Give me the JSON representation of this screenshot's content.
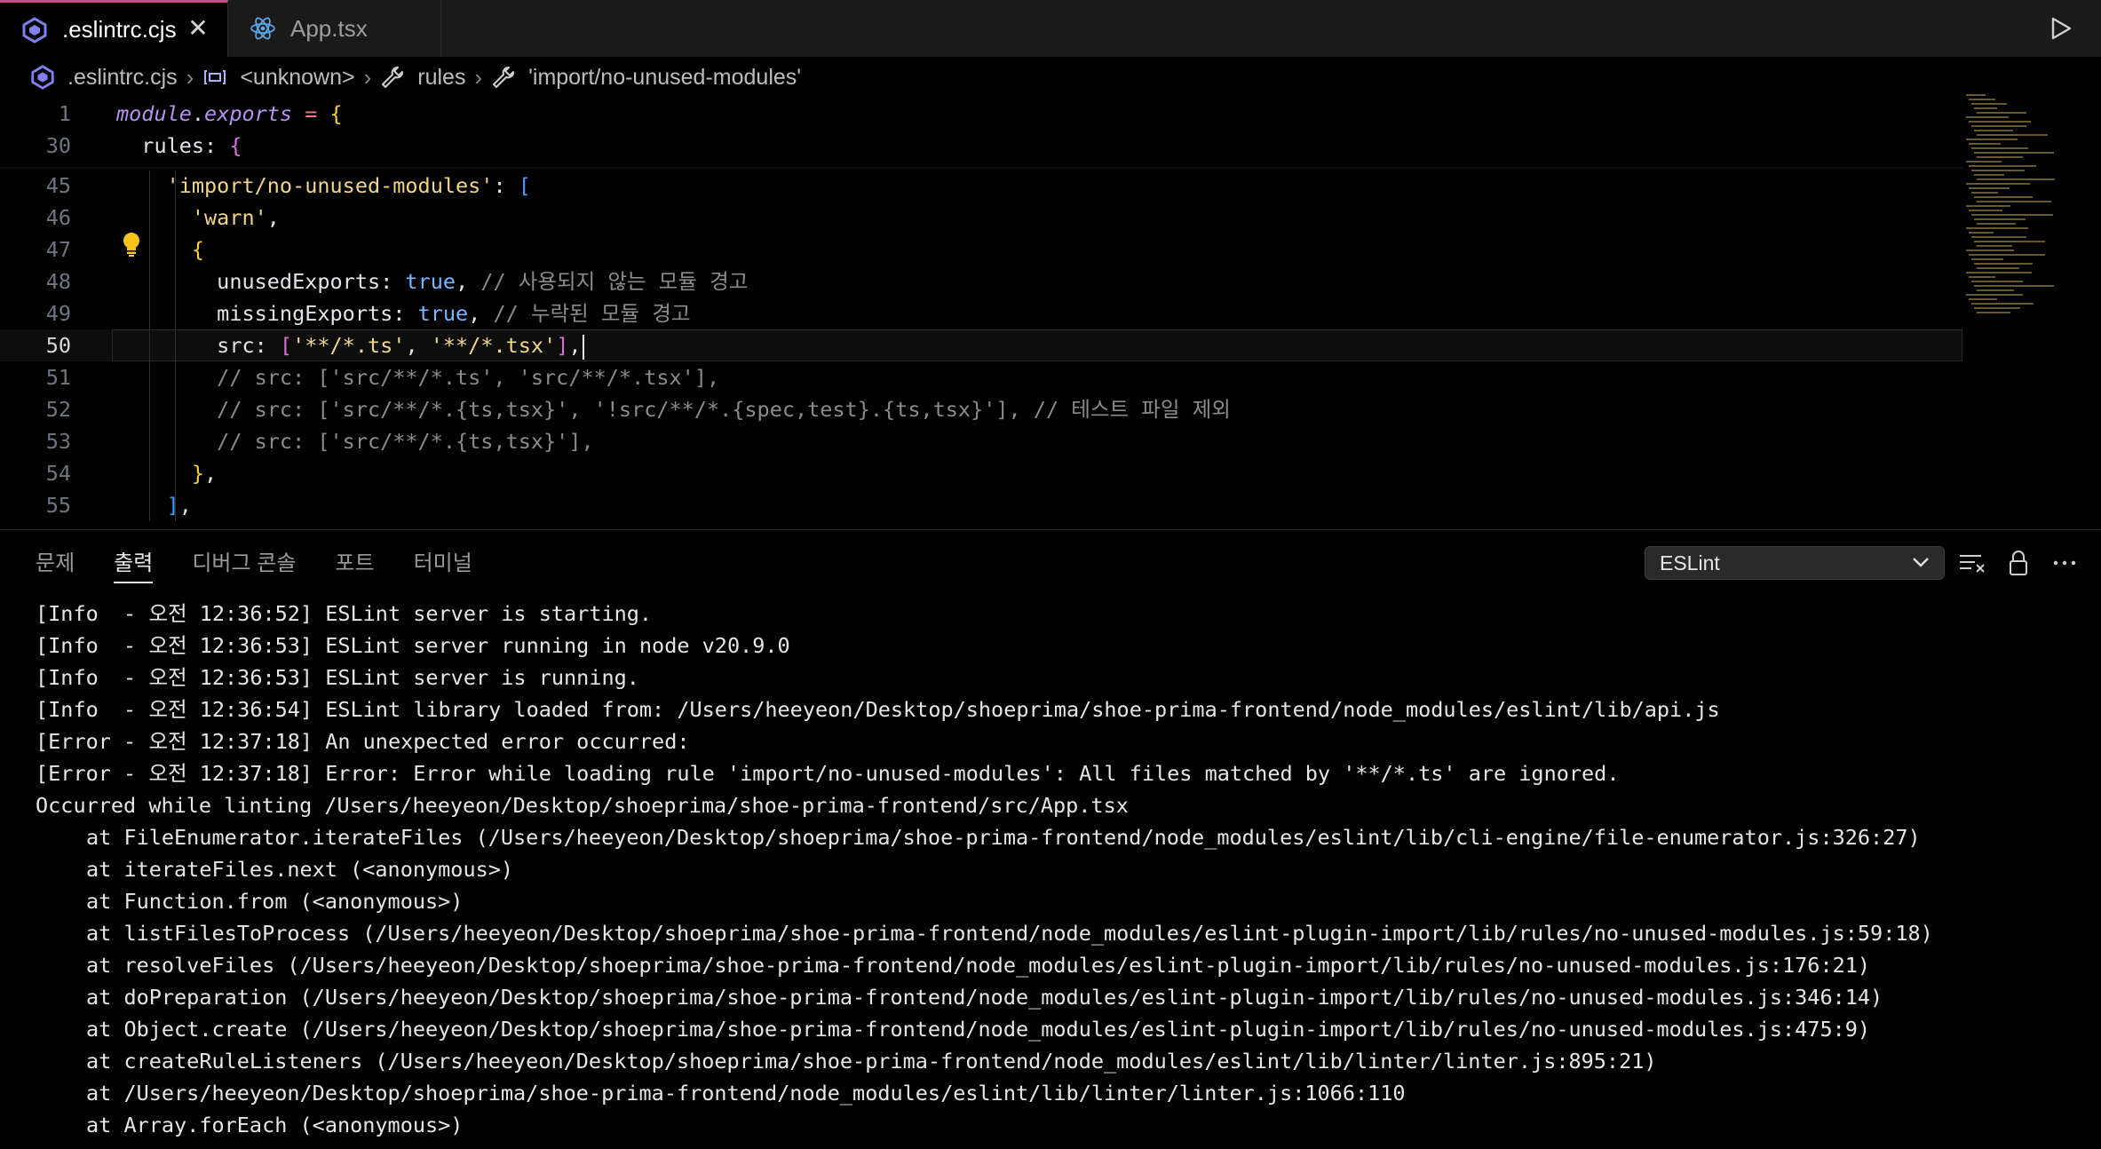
{
  "tabs": [
    {
      "label": ".eslintrc.cjs",
      "active": true,
      "icon": "eslint-icon"
    },
    {
      "label": "App.tsx",
      "active": false,
      "icon": "react-icon"
    }
  ],
  "breadcrumb": [
    {
      "label": ".eslintrc.cjs",
      "icon": "eslint-icon"
    },
    {
      "label": "<unknown>",
      "icon": "variable-icon"
    },
    {
      "label": "rules",
      "icon": "wrench-icon"
    },
    {
      "label": "'import/no-unused-modules'",
      "icon": "wrench-icon"
    }
  ],
  "editor": {
    "lines": [
      {
        "n": "1",
        "tokens": [
          {
            "t": "module",
            "c": "kw-i"
          },
          {
            "t": ".",
            "c": "prop"
          },
          {
            "t": "exports",
            "c": "kw-i"
          },
          {
            "t": " = ",
            "c": "op"
          },
          {
            "t": "{",
            "c": "br1"
          }
        ]
      },
      {
        "n": "30",
        "tokens": [
          {
            "t": "  rules",
            "c": "prop"
          },
          {
            "t": ": ",
            "c": "prop"
          },
          {
            "t": "{",
            "c": "br2"
          }
        ]
      },
      {
        "n": "45",
        "tokens": [
          {
            "t": "    ",
            "c": "prop"
          },
          {
            "t": "'import/no-unused-modules'",
            "c": "str"
          },
          {
            "t": ": ",
            "c": "prop"
          },
          {
            "t": "[",
            "c": "br3"
          }
        ]
      },
      {
        "n": "46",
        "tokens": [
          {
            "t": "      ",
            "c": "prop"
          },
          {
            "t": "'warn'",
            "c": "str"
          },
          {
            "t": ",",
            "c": "prop"
          }
        ]
      },
      {
        "n": "47",
        "tokens": [
          {
            "t": "      ",
            "c": "prop"
          },
          {
            "t": "{",
            "c": "br1"
          }
        ]
      },
      {
        "n": "48",
        "tokens": [
          {
            "t": "        unusedExports: ",
            "c": "prop"
          },
          {
            "t": "true",
            "c": "bool"
          },
          {
            "t": ", ",
            "c": "prop"
          },
          {
            "t": "// 사용되지 않는 모듈 경고",
            "c": "cmt"
          }
        ]
      },
      {
        "n": "49",
        "tokens": [
          {
            "t": "        missingExports: ",
            "c": "prop"
          },
          {
            "t": "true",
            "c": "bool"
          },
          {
            "t": ", ",
            "c": "prop"
          },
          {
            "t": "// 누락된 모듈 경고",
            "c": "cmt"
          }
        ]
      },
      {
        "n": "50",
        "current": true,
        "tokens": [
          {
            "t": "        src: ",
            "c": "prop"
          },
          {
            "t": "[",
            "c": "br2"
          },
          {
            "t": "'**/*.ts'",
            "c": "str"
          },
          {
            "t": ", ",
            "c": "prop"
          },
          {
            "t": "'**/*.tsx'",
            "c": "str"
          },
          {
            "t": "]",
            "c": "br2"
          },
          {
            "t": ",",
            "c": "prop"
          }
        ]
      },
      {
        "n": "51",
        "tokens": [
          {
            "t": "        // src: ['src/**/*.ts', 'src/**/*.tsx'],",
            "c": "cmt"
          }
        ]
      },
      {
        "n": "52",
        "tokens": [
          {
            "t": "        // src: ['src/**/*.{ts,tsx}', '!src/**/*.{spec,test}.{ts,tsx}'], // 테스트 파일 제외",
            "c": "cmt"
          }
        ]
      },
      {
        "n": "53",
        "tokens": [
          {
            "t": "        // src: ['src/**/*.{ts,tsx}'],",
            "c": "cmt"
          }
        ]
      },
      {
        "n": "54",
        "tokens": [
          {
            "t": "      ",
            "c": "prop"
          },
          {
            "t": "}",
            "c": "br1"
          },
          {
            "t": ",",
            "c": "prop"
          }
        ]
      },
      {
        "n": "55",
        "tokens": [
          {
            "t": "    ",
            "c": "prop"
          },
          {
            "t": "]",
            "c": "br3"
          },
          {
            "t": ",",
            "c": "prop"
          }
        ]
      }
    ]
  },
  "panel": {
    "tabs": [
      "문제",
      "출력",
      "디버그 콘솔",
      "포트",
      "터미널"
    ],
    "active_tab": "출력",
    "channel": "ESLint",
    "output_lines": [
      {
        "text": "[Info  - 오전 12:36:52] ESLint server is starting.",
        "indent": false
      },
      {
        "text": "[Info  - 오전 12:36:53] ESLint server running in node v20.9.0",
        "indent": false
      },
      {
        "text": "[Info  - 오전 12:36:53] ESLint server is running.",
        "indent": false
      },
      {
        "text": "[Info  - 오전 12:36:54] ESLint library loaded from: /Users/heeyeon/Desktop/shoeprima/shoe-prima-frontend/node_modules/eslint/lib/api.js",
        "indent": false
      },
      {
        "text": "[Error - 오전 12:37:18] An unexpected error occurred:",
        "indent": false
      },
      {
        "text": "[Error - 오전 12:37:18] Error: Error while loading rule 'import/no-unused-modules': All files matched by '**/*.ts' are ignored.",
        "indent": false
      },
      {
        "text": "Occurred while linting /Users/heeyeon/Desktop/shoeprima/shoe-prima-frontend/src/App.tsx",
        "indent": false
      },
      {
        "text": "at FileEnumerator.iterateFiles (/Users/heeyeon/Desktop/shoeprima/shoe-prima-frontend/node_modules/eslint/lib/cli-engine/file-enumerator.js:326:27)",
        "indent": true
      },
      {
        "text": "at iterateFiles.next (<anonymous>)",
        "indent": true
      },
      {
        "text": "at Function.from (<anonymous>)",
        "indent": true
      },
      {
        "text": "at listFilesToProcess (/Users/heeyeon/Desktop/shoeprima/shoe-prima-frontend/node_modules/eslint-plugin-import/lib/rules/no-unused-modules.js:59:18)",
        "indent": true
      },
      {
        "text": "at resolveFiles (/Users/heeyeon/Desktop/shoeprima/shoe-prima-frontend/node_modules/eslint-plugin-import/lib/rules/no-unused-modules.js:176:21)",
        "indent": true
      },
      {
        "text": "at doPreparation (/Users/heeyeon/Desktop/shoeprima/shoe-prima-frontend/node_modules/eslint-plugin-import/lib/rules/no-unused-modules.js:346:14)",
        "indent": true
      },
      {
        "text": "at Object.create (/Users/heeyeon/Desktop/shoeprima/shoe-prima-frontend/node_modules/eslint-plugin-import/lib/rules/no-unused-modules.js:475:9)",
        "indent": true
      },
      {
        "text": "at createRuleListeners (/Users/heeyeon/Desktop/shoeprima/shoe-prima-frontend/node_modules/eslint/lib/linter/linter.js:895:21)",
        "indent": true
      },
      {
        "text": "at /Users/heeyeon/Desktop/shoeprima/shoe-prima-frontend/node_modules/eslint/lib/linter/linter.js:1066:110",
        "indent": true
      },
      {
        "text": "at Array.forEach (<anonymous>)",
        "indent": true
      }
    ]
  },
  "colors": {
    "accent": "#c74b8a",
    "string": "#f0d689",
    "boolean": "#79b8ff",
    "keyword": "#b392f0",
    "comment": "#8b8b8b"
  }
}
